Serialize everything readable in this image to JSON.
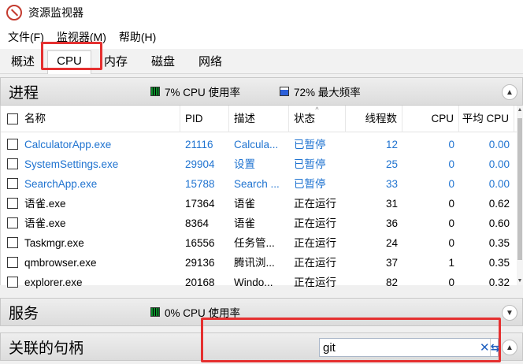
{
  "window": {
    "title": "资源监视器"
  },
  "menu": [
    "文件(F)",
    "监视器(M)",
    "帮助(H)"
  ],
  "tabs": [
    "概述",
    "CPU",
    "内存",
    "磁盘",
    "网络"
  ],
  "active_tab": "CPU",
  "processes": {
    "title": "进程",
    "cpu_usage": "7% CPU 使用率",
    "max_freq": "72% 最大频率",
    "columns": [
      "名称",
      "PID",
      "描述",
      "状态",
      "线程数",
      "CPU",
      "平均 CPU"
    ],
    "rows": [
      {
        "name": "CalculatorApp.exe",
        "pid": "21116",
        "desc": "Calcula...",
        "status": "已暂停",
        "threads": "12",
        "cpu": "0",
        "avg": "0.00",
        "suspended": true
      },
      {
        "name": "SystemSettings.exe",
        "pid": "29904",
        "desc": "设置",
        "status": "已暂停",
        "threads": "25",
        "cpu": "0",
        "avg": "0.00",
        "suspended": true
      },
      {
        "name": "SearchApp.exe",
        "pid": "15788",
        "desc": "Search ...",
        "status": "已暂停",
        "threads": "33",
        "cpu": "0",
        "avg": "0.00",
        "suspended": true
      },
      {
        "name": "语雀.exe",
        "pid": "17364",
        "desc": "语雀",
        "status": "正在运行",
        "threads": "31",
        "cpu": "0",
        "avg": "0.62",
        "suspended": false
      },
      {
        "name": "语雀.exe",
        "pid": "8364",
        "desc": "语雀",
        "status": "正在运行",
        "threads": "36",
        "cpu": "0",
        "avg": "0.60",
        "suspended": false
      },
      {
        "name": "Taskmgr.exe",
        "pid": "16556",
        "desc": "任务管...",
        "status": "正在运行",
        "threads": "24",
        "cpu": "0",
        "avg": "0.35",
        "suspended": false
      },
      {
        "name": "qmbrowser.exe",
        "pid": "29136",
        "desc": "腾讯浏...",
        "status": "正在运行",
        "threads": "37",
        "cpu": "1",
        "avg": "0.35",
        "suspended": false
      },
      {
        "name": "explorer.exe",
        "pid": "20168",
        "desc": "Windo...",
        "status": "正在运行",
        "threads": "82",
        "cpu": "0",
        "avg": "0.32",
        "suspended": false
      }
    ]
  },
  "services": {
    "title": "服务",
    "cpu_usage": "0% CPU 使用率"
  },
  "handles": {
    "title": "关联的句柄",
    "search_value": "git"
  },
  "colors": {
    "link_blue": "#1f73d0",
    "highlight_red": "#e53030"
  }
}
